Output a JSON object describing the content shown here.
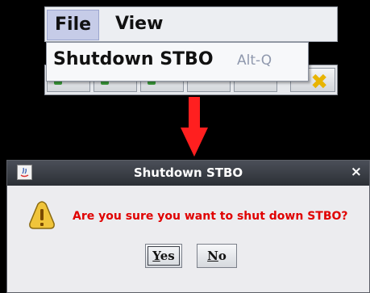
{
  "menubar": {
    "items": [
      {
        "label": "File"
      },
      {
        "label": "View"
      }
    ]
  },
  "menu_file": {
    "item_label": "Shutdown STBO",
    "item_accelerator": "Alt-Q"
  },
  "dialog": {
    "title": "Shutdown STBO",
    "close_glyph": "×",
    "message": "Are you sure you want to shut down STBO?",
    "buttons": [
      {
        "label_mnemonic": "Y",
        "label_rest": "es"
      },
      {
        "label_mnemonic": "N",
        "label_rest": "o"
      }
    ]
  },
  "colors": {
    "arrow": "#ff1f1f",
    "message": "#e00000",
    "warning_fill": "#f0c43a"
  },
  "icons": {
    "java_app": "java-icon",
    "warning": "warning-icon",
    "arrow": "red-down-arrow",
    "toolbar_exit": "exit-x-icon"
  }
}
